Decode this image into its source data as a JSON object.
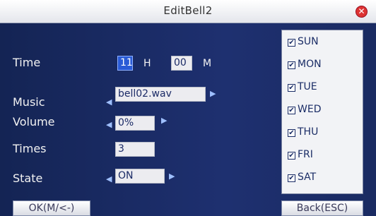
{
  "window": {
    "title": "EditBell2",
    "close_glyph": "✕"
  },
  "form": {
    "time": {
      "label": "Time",
      "hour": "11",
      "hour_unit": "H",
      "minute": "00",
      "minute_unit": "M"
    },
    "music": {
      "label": "Music",
      "value": "bell02.wav"
    },
    "volume": {
      "label": "Volume",
      "value": "0%"
    },
    "times": {
      "label": "Times",
      "value": "3"
    },
    "state": {
      "label": "State",
      "value": "ON"
    }
  },
  "days": [
    {
      "label": "SUN",
      "checked": true
    },
    {
      "label": "MON",
      "checked": true
    },
    {
      "label": "TUE",
      "checked": true
    },
    {
      "label": "WED",
      "checked": true
    },
    {
      "label": "THU",
      "checked": true
    },
    {
      "label": "FRI",
      "checked": true
    },
    {
      "label": "SAT",
      "checked": true
    }
  ],
  "buttons": {
    "ok": "OK(M/<-)",
    "back": "Back(ESC)"
  },
  "icons": {
    "left_arrow": "◀",
    "right_arrow": "▶",
    "check": "✔"
  }
}
